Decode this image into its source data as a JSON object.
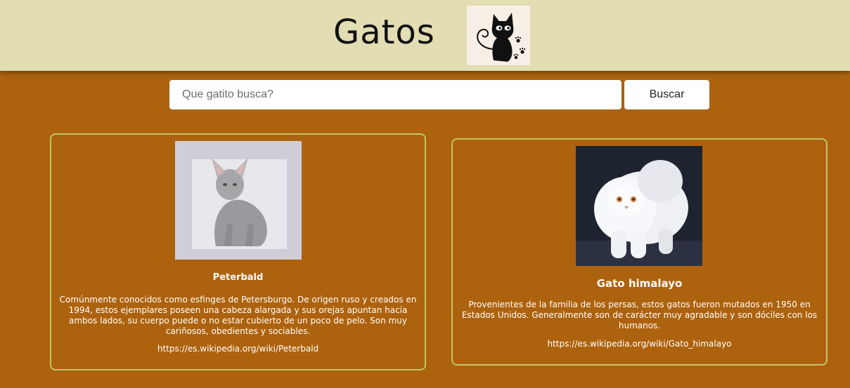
{
  "header": {
    "title": "Gatos",
    "logo_icon": "black-cat-logo-icon"
  },
  "search": {
    "placeholder": "Que gatito busca?",
    "value": "",
    "button_label": "Buscar"
  },
  "cards": [
    {
      "name": "Peterbald",
      "image_icon": "peterbald-cat-photo",
      "description": "Comúnmente conocidos como esfinges de Petersburgo. De origen ruso y creados en 1994, estos ejemplares poseen una cabeza alargada y sus orejas apuntan hacia ambos lados, su cuerpo puede o no estar cubierto de un poco de pelo. Son muy cariñosos, obedientes y sociables.",
      "link": "https://es.wikipedia.org/wiki/Peterbald"
    },
    {
      "name": "Gato himalayo",
      "image_icon": "himalayan-cat-photo",
      "description": "Provenientes de la familia de los persas, estos gatos fueron mutados en 1950 en Estados Unidos. Generalmente son de carácter muy agradable y son dóciles con los humanos.",
      "link": "https://es.wikipedia.org/wiki/Gato_himalayo"
    }
  ],
  "colors": {
    "page_background": "#ad620d",
    "header_background": "#e2ddb2",
    "card_border": "#c3c56a",
    "text_light": "#ffffff"
  }
}
